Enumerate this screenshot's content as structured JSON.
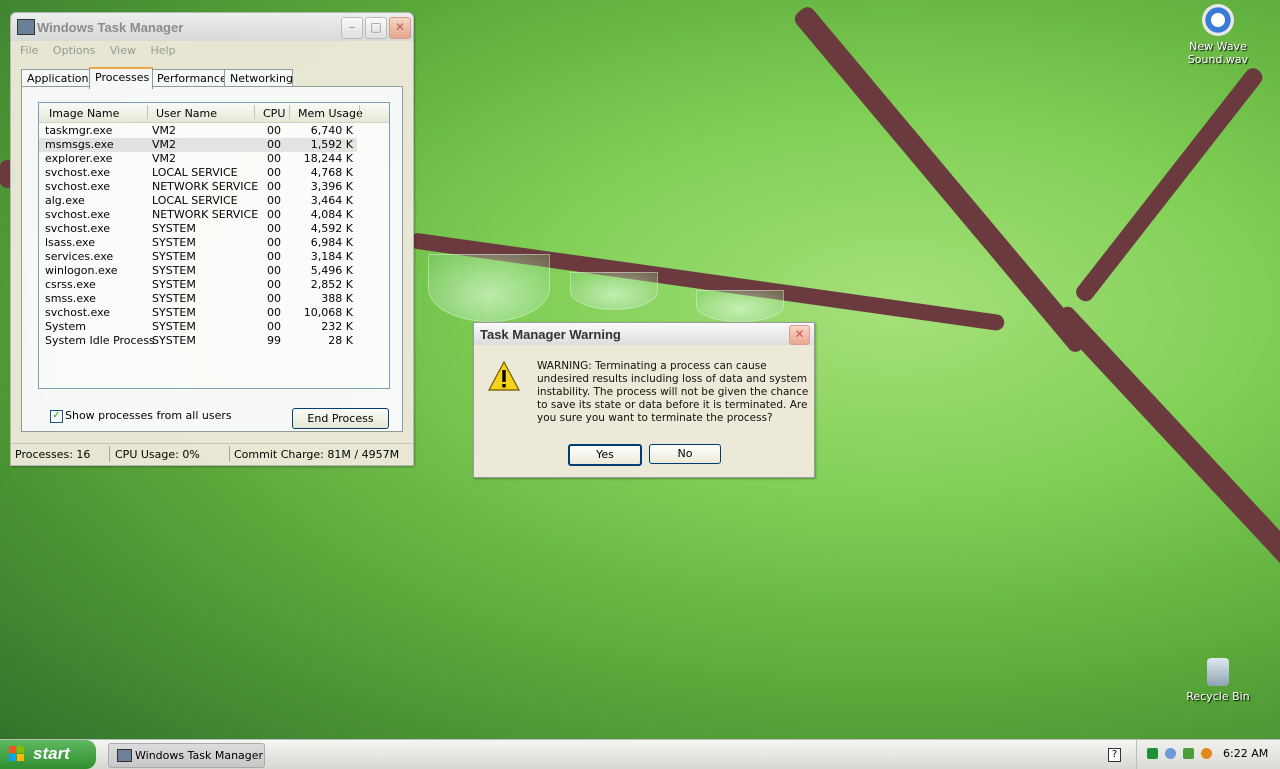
{
  "desktop": {
    "icons": [
      {
        "name": "New Wave Sound.wav",
        "glyph": "media-file-icon"
      },
      {
        "name": "Recycle Bin",
        "glyph": "recycle-bin-icon"
      }
    ]
  },
  "taskmgr": {
    "title": "Windows Task Manager",
    "menu": [
      "File",
      "Options",
      "View",
      "Help"
    ],
    "tabs": [
      "Applications",
      "Processes",
      "Performance",
      "Networking"
    ],
    "active_tab": "Processes",
    "columns": [
      "Image Name",
      "User Name",
      "CPU",
      "Mem Usage"
    ],
    "rows": [
      {
        "image": "taskmgr.exe",
        "user": "VM2",
        "cpu": "00",
        "mem": "6,740 K"
      },
      {
        "image": "msmsgs.exe",
        "user": "VM2",
        "cpu": "00",
        "mem": "1,592 K"
      },
      {
        "image": "explorer.exe",
        "user": "VM2",
        "cpu": "00",
        "mem": "18,244 K"
      },
      {
        "image": "svchost.exe",
        "user": "LOCAL SERVICE",
        "cpu": "00",
        "mem": "4,768 K"
      },
      {
        "image": "svchost.exe",
        "user": "NETWORK SERVICE",
        "cpu": "00",
        "mem": "3,396 K"
      },
      {
        "image": "alg.exe",
        "user": "LOCAL SERVICE",
        "cpu": "00",
        "mem": "3,464 K"
      },
      {
        "image": "svchost.exe",
        "user": "NETWORK SERVICE",
        "cpu": "00",
        "mem": "4,084 K"
      },
      {
        "image": "svchost.exe",
        "user": "SYSTEM",
        "cpu": "00",
        "mem": "4,592 K"
      },
      {
        "image": "lsass.exe",
        "user": "SYSTEM",
        "cpu": "00",
        "mem": "6,984 K"
      },
      {
        "image": "services.exe",
        "user": "SYSTEM",
        "cpu": "00",
        "mem": "3,184 K"
      },
      {
        "image": "winlogon.exe",
        "user": "SYSTEM",
        "cpu": "00",
        "mem": "5,496 K"
      },
      {
        "image": "csrss.exe",
        "user": "SYSTEM",
        "cpu": "00",
        "mem": "2,852 K"
      },
      {
        "image": "smss.exe",
        "user": "SYSTEM",
        "cpu": "00",
        "mem": "388 K"
      },
      {
        "image": "svchost.exe",
        "user": "SYSTEM",
        "cpu": "00",
        "mem": "10,068 K"
      },
      {
        "image": "System",
        "user": "SYSTEM",
        "cpu": "00",
        "mem": "232 K"
      },
      {
        "image": "System Idle Process",
        "user": "SYSTEM",
        "cpu": "99",
        "mem": "28 K"
      }
    ],
    "selected_row": "msmsgs.exe",
    "show_all_label": "Show processes from all users",
    "show_all_checked": "✓",
    "end_process_label": "End Process",
    "status": {
      "processes": "Processes: 16",
      "cpu": "CPU Usage: 0%",
      "commit": "Commit Charge: 81M / 4957M"
    }
  },
  "dialog": {
    "title": "Task Manager Warning",
    "message": "WARNING: Terminating a process can cause undesired results including loss of data and system instability. The process will not be given the chance to save its state or data before it is terminated.  Are you sure you want to terminate the process?",
    "yes_label": "Yes",
    "no_label": "No"
  },
  "taskbar": {
    "start_label": "start",
    "task_button": "Windows Task Manager",
    "clock": "6:22 AM"
  }
}
